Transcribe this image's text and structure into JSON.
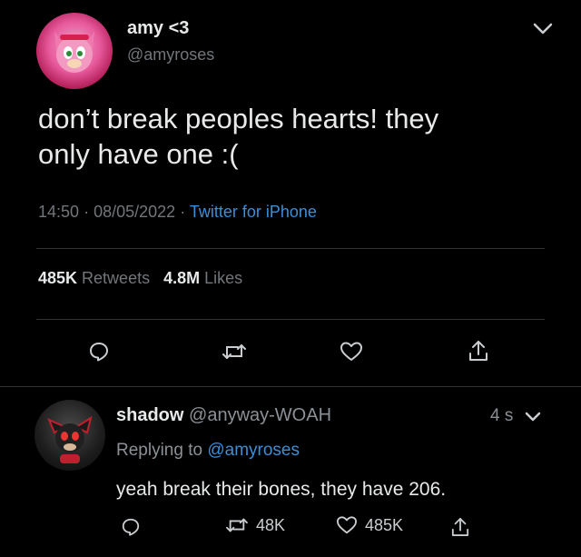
{
  "tweet": {
    "display_name": "amy <3",
    "handle": "@amyroses",
    "text_line1": "don’t break peoples hearts! they",
    "text_line2": "only have one :(",
    "time": "14:50",
    "sep1": "·",
    "date": "08/05/2022",
    "sep2": "·",
    "source": "Twitter for iPhone",
    "retweets_count": "485K",
    "retweets_label": "Retweets",
    "likes_count": "4.8M",
    "likes_label": "Likes",
    "avatar_color": "#e83e8c"
  },
  "reply": {
    "display_name": "shadow",
    "handle": "@anyway-WOAH",
    "age": "4 s",
    "replying_label": "Replying to",
    "replying_handle": "@amyroses",
    "text": "yeah break their bones, they have 206.",
    "retweets": "48K",
    "likes": "485K"
  },
  "colors": {
    "background": "#000000",
    "text": "#e7e9ea",
    "muted": "#71767b",
    "link": "#3b8fd8",
    "divider": "#2f3336"
  }
}
